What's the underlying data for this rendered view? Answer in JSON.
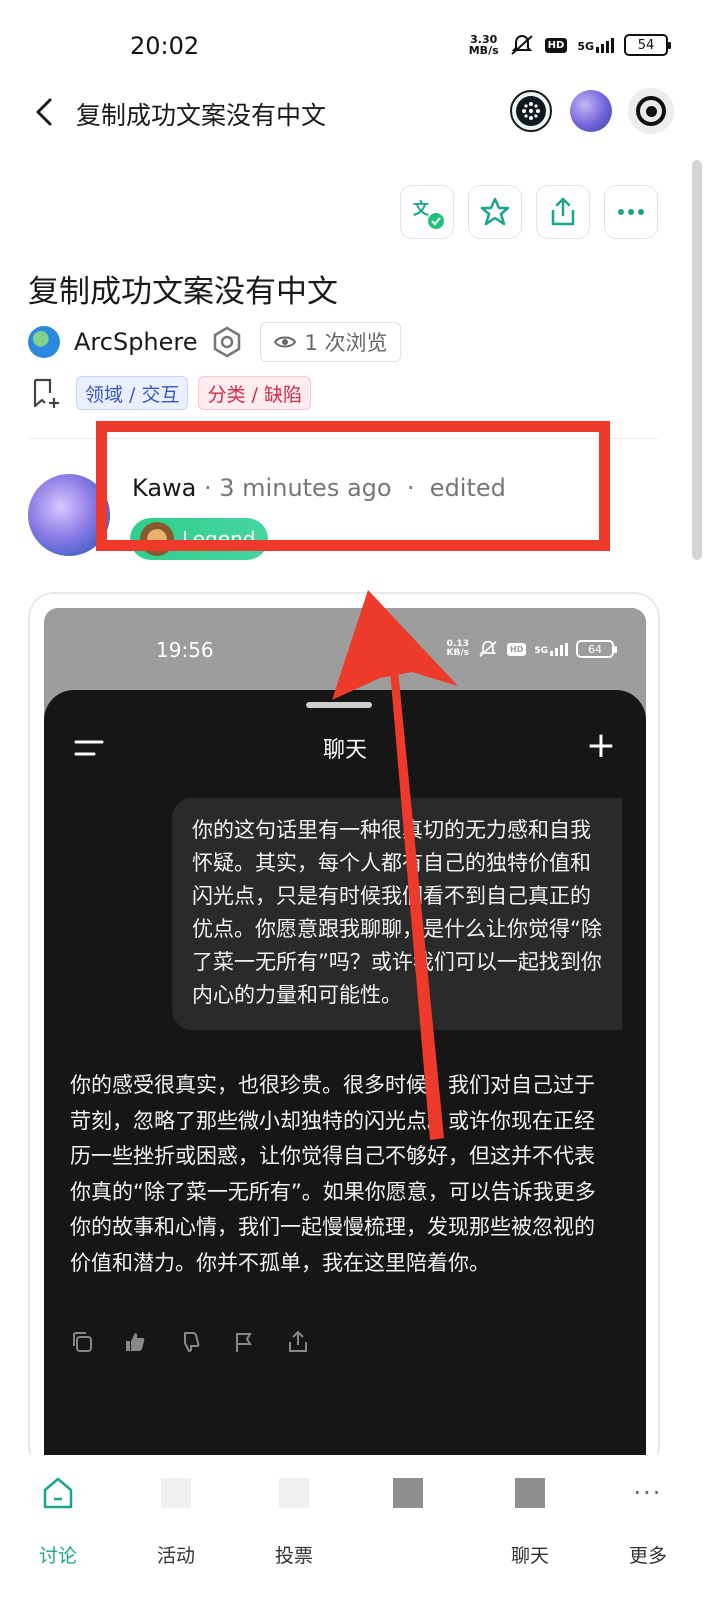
{
  "status_bar": {
    "time": "20:02",
    "net_speed_value": "3.30",
    "net_speed_unit": "MB/s",
    "hd": "HD",
    "network": "5G",
    "battery": "54"
  },
  "header": {
    "title": "复制成功文案没有中文"
  },
  "post": {
    "title": "复制成功文案没有中文",
    "author": "ArcSphere",
    "views": "1 次浏览",
    "tags": [
      {
        "label": "领域 / 交互",
        "color": "#3856c8"
      },
      {
        "label": "分类 / 缺陷",
        "color": "#d22a4a"
      }
    ]
  },
  "comment": {
    "author": "Kawa",
    "separator": "·",
    "time": "3 minutes ago",
    "edited": "edited",
    "badge": "Legend"
  },
  "embedded_screenshot": {
    "status_time": "19:56",
    "net_speed_value": "0.13",
    "net_speed_unit": "KB/s",
    "hd": "HD",
    "network": "5G",
    "battery": "64",
    "chat_title": "聊天",
    "user_message": "你的这句话里有一种很真切的无力感和自我怀疑。其实，每个人都有自己的独特价值和闪光点，只是有时候我们看不到自己真正的优点。你愿意跟我聊聊，是什么让你觉得“除了菜一无所有”吗？或许我们可以一起找到你内心的力量和可能性。",
    "ai_reply": "你的感受很真实，也很珍贵。很多时候，我们对自己过于苛刻，忽略了那些微小却独特的闪光点。或许你现在正经历一些挫折或困惑，让你觉得自己不够好，但这并不代表你真的“除了菜一无所有”。如果你愿意，可以告诉我更多你的故事和心情，我们一起慢慢梳理，发现那些被忽视的价值和潜力。你并不孤单，我在这里陪着你。"
  },
  "bottom_nav": {
    "items": [
      {
        "label": "讨论",
        "icon": "home-icon",
        "active": true
      },
      {
        "label": "活动",
        "icon": "activity-icon"
      },
      {
        "label": "投票",
        "icon": "vote-icon"
      },
      {
        "label": "",
        "icon": "blurred-icon"
      },
      {
        "label": "聊天",
        "icon": "chat-icon"
      },
      {
        "label": "更多",
        "icon": "more-icon"
      }
    ]
  },
  "colors": {
    "accent": "#1aa48b",
    "highlight": "#ee3a2a",
    "legend_badge": "#2fcf8e"
  }
}
